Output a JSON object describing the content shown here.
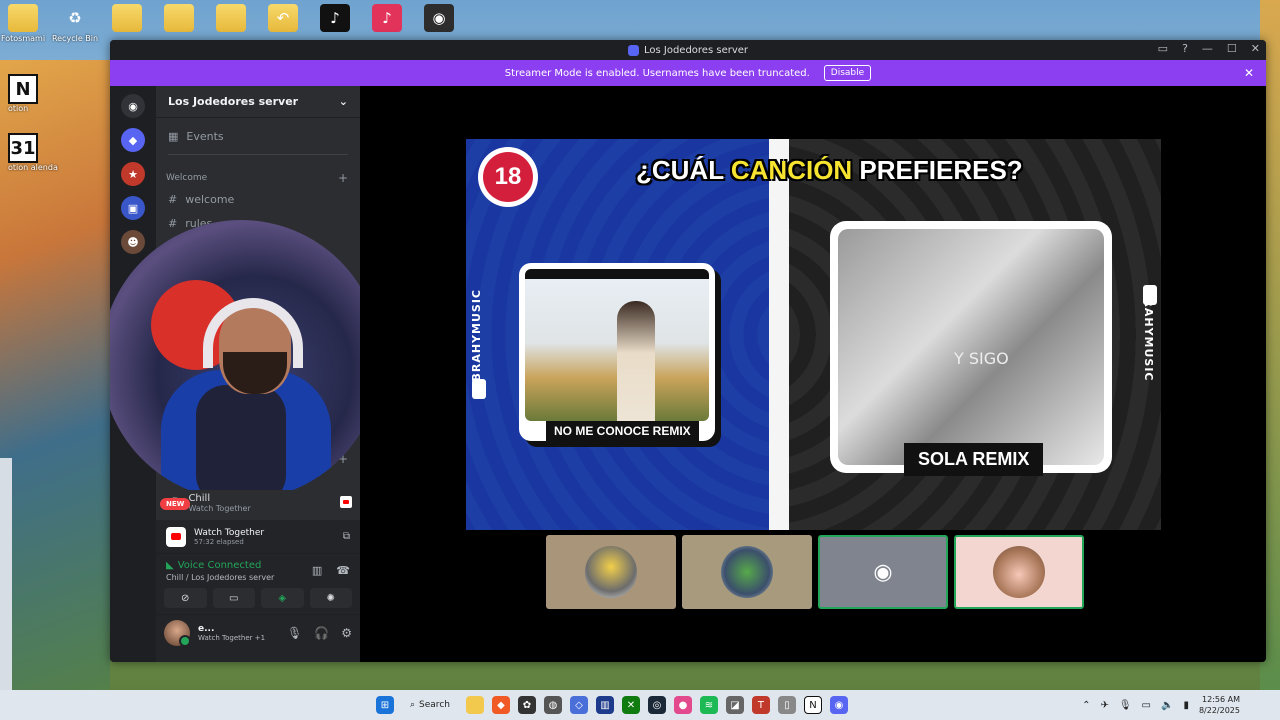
{
  "desktop": {
    "icons": [
      {
        "label": "Fotosmami",
        "icon": "folder-icon"
      },
      {
        "label": "Recycle Bin",
        "icon": "recycle-bin-icon"
      },
      {
        "label": "",
        "icon": "folder-icon"
      },
      {
        "label": "",
        "icon": "folder-icon"
      },
      {
        "label": "",
        "icon": "folder-icon"
      },
      {
        "label": "",
        "icon": "folder-icon"
      },
      {
        "label": "",
        "icon": "tiktok-icon"
      },
      {
        "label": "",
        "icon": "tiktok-studio-icon"
      },
      {
        "label": "",
        "icon": "obs-icon"
      }
    ],
    "side_icons": [
      {
        "glyph": "N",
        "label": "otion"
      },
      {
        "glyph": "31",
        "label": "otion\nalenda"
      }
    ]
  },
  "window": {
    "title": "Los Jodedores server",
    "controls": [
      "▭",
      "?",
      "—",
      "☐",
      "✕"
    ]
  },
  "banner": {
    "text": "Streamer Mode is enabled. Usernames have been truncated.",
    "button": "Disable",
    "close": "✕"
  },
  "sidebar": {
    "server_name": "Los Jodedores server",
    "events": "Events",
    "category": "Welcome",
    "channels": [
      "welcome",
      "rules"
    ],
    "voice": {
      "name": "Chill",
      "sub": "Watch Together",
      "new_badge": "NEW"
    }
  },
  "panel": {
    "activity": {
      "title": "Watch Together",
      "elapsed": "57:32 elapsed"
    },
    "voice": {
      "state": "Voice Connected",
      "where": "Chill / Los Jodedores server"
    },
    "user": {
      "name": "e...",
      "status": "Watch Together +1"
    }
  },
  "video": {
    "badge": "18",
    "title_pre": "¿CUÁL ",
    "title_hl": "CANCIÓN",
    "title_post": " PREFIERES?",
    "brand": "BRAHYMUSIC",
    "left_caption": "NO ME CONOCE REMIX",
    "right_caption": "SOLA REMIX",
    "right_overlay": "Y SIGO"
  },
  "taskbar": {
    "search_label": "Search",
    "time": "12:56 AM",
    "date": "8/22/2025"
  },
  "colors": {
    "banner": "#8c3ff0",
    "voice_green": "#23a55a",
    "title_yellow": "#f7e431",
    "badge_red": "#d41f3c"
  }
}
